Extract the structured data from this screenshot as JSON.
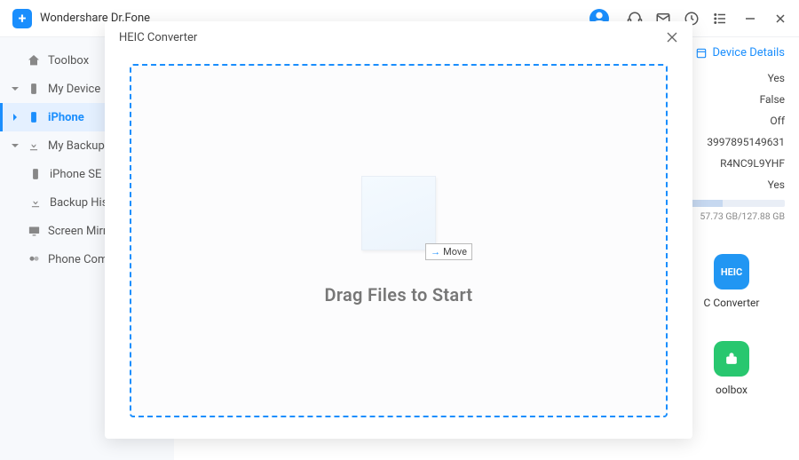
{
  "app": {
    "title": "Wondershare Dr.Fone"
  },
  "sidebar": {
    "toolbox": "Toolbox",
    "my_device": "My Device",
    "iphone": "iPhone",
    "my_backup": "My Backup",
    "iphone_se": "iPhone SE",
    "backup_history": "Backup History",
    "screen_mirror": "Screen Mirror",
    "phone_companion": "Phone Companion"
  },
  "right": {
    "device_details": "Device Details",
    "rows": {
      "r1": "Yes",
      "r2": "False",
      "r3": "Off",
      "r4": "3997895149631",
      "r5": "R4NC9L9YHF",
      "r6": "Yes"
    },
    "storage": "57.73 GB/127.88 GB"
  },
  "tools": {
    "heic_badge": "HEIC",
    "heic_label": "C Converter",
    "toolbox_label": "oolbox"
  },
  "modal": {
    "title": "HEIC Converter",
    "move_label": "Move",
    "drop_text": "Drag  Files to Start"
  }
}
